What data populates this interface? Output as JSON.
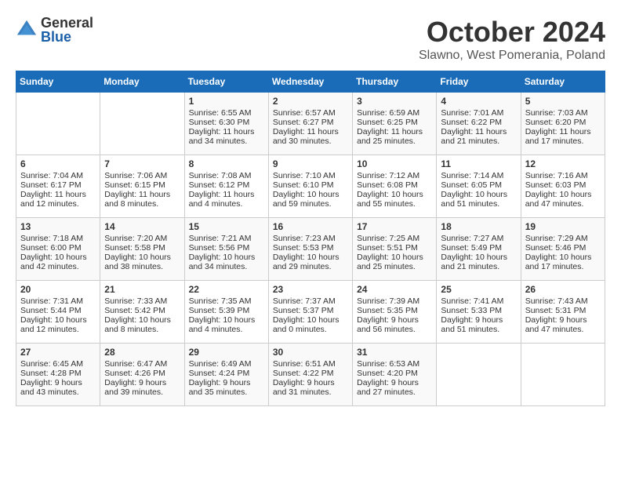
{
  "header": {
    "logo_general": "General",
    "logo_blue": "Blue",
    "month_title": "October 2024",
    "location": "Slawno, West Pomerania, Poland"
  },
  "weekdays": [
    "Sunday",
    "Monday",
    "Tuesday",
    "Wednesday",
    "Thursday",
    "Friday",
    "Saturday"
  ],
  "weeks": [
    [
      {
        "day": "",
        "content": ""
      },
      {
        "day": "",
        "content": ""
      },
      {
        "day": "1",
        "content": "Sunrise: 6:55 AM\nSunset: 6:30 PM\nDaylight: 11 hours\nand 34 minutes."
      },
      {
        "day": "2",
        "content": "Sunrise: 6:57 AM\nSunset: 6:27 PM\nDaylight: 11 hours\nand 30 minutes."
      },
      {
        "day": "3",
        "content": "Sunrise: 6:59 AM\nSunset: 6:25 PM\nDaylight: 11 hours\nand 25 minutes."
      },
      {
        "day": "4",
        "content": "Sunrise: 7:01 AM\nSunset: 6:22 PM\nDaylight: 11 hours\nand 21 minutes."
      },
      {
        "day": "5",
        "content": "Sunrise: 7:03 AM\nSunset: 6:20 PM\nDaylight: 11 hours\nand 17 minutes."
      }
    ],
    [
      {
        "day": "6",
        "content": "Sunrise: 7:04 AM\nSunset: 6:17 PM\nDaylight: 11 hours\nand 12 minutes."
      },
      {
        "day": "7",
        "content": "Sunrise: 7:06 AM\nSunset: 6:15 PM\nDaylight: 11 hours\nand 8 minutes."
      },
      {
        "day": "8",
        "content": "Sunrise: 7:08 AM\nSunset: 6:12 PM\nDaylight: 11 hours\nand 4 minutes."
      },
      {
        "day": "9",
        "content": "Sunrise: 7:10 AM\nSunset: 6:10 PM\nDaylight: 10 hours\nand 59 minutes."
      },
      {
        "day": "10",
        "content": "Sunrise: 7:12 AM\nSunset: 6:08 PM\nDaylight: 10 hours\nand 55 minutes."
      },
      {
        "day": "11",
        "content": "Sunrise: 7:14 AM\nSunset: 6:05 PM\nDaylight: 10 hours\nand 51 minutes."
      },
      {
        "day": "12",
        "content": "Sunrise: 7:16 AM\nSunset: 6:03 PM\nDaylight: 10 hours\nand 47 minutes."
      }
    ],
    [
      {
        "day": "13",
        "content": "Sunrise: 7:18 AM\nSunset: 6:00 PM\nDaylight: 10 hours\nand 42 minutes."
      },
      {
        "day": "14",
        "content": "Sunrise: 7:20 AM\nSunset: 5:58 PM\nDaylight: 10 hours\nand 38 minutes."
      },
      {
        "day": "15",
        "content": "Sunrise: 7:21 AM\nSunset: 5:56 PM\nDaylight: 10 hours\nand 34 minutes."
      },
      {
        "day": "16",
        "content": "Sunrise: 7:23 AM\nSunset: 5:53 PM\nDaylight: 10 hours\nand 29 minutes."
      },
      {
        "day": "17",
        "content": "Sunrise: 7:25 AM\nSunset: 5:51 PM\nDaylight: 10 hours\nand 25 minutes."
      },
      {
        "day": "18",
        "content": "Sunrise: 7:27 AM\nSunset: 5:49 PM\nDaylight: 10 hours\nand 21 minutes."
      },
      {
        "day": "19",
        "content": "Sunrise: 7:29 AM\nSunset: 5:46 PM\nDaylight: 10 hours\nand 17 minutes."
      }
    ],
    [
      {
        "day": "20",
        "content": "Sunrise: 7:31 AM\nSunset: 5:44 PM\nDaylight: 10 hours\nand 12 minutes."
      },
      {
        "day": "21",
        "content": "Sunrise: 7:33 AM\nSunset: 5:42 PM\nDaylight: 10 hours\nand 8 minutes."
      },
      {
        "day": "22",
        "content": "Sunrise: 7:35 AM\nSunset: 5:39 PM\nDaylight: 10 hours\nand 4 minutes."
      },
      {
        "day": "23",
        "content": "Sunrise: 7:37 AM\nSunset: 5:37 PM\nDaylight: 10 hours\nand 0 minutes."
      },
      {
        "day": "24",
        "content": "Sunrise: 7:39 AM\nSunset: 5:35 PM\nDaylight: 9 hours\nand 56 minutes."
      },
      {
        "day": "25",
        "content": "Sunrise: 7:41 AM\nSunset: 5:33 PM\nDaylight: 9 hours\nand 51 minutes."
      },
      {
        "day": "26",
        "content": "Sunrise: 7:43 AM\nSunset: 5:31 PM\nDaylight: 9 hours\nand 47 minutes."
      }
    ],
    [
      {
        "day": "27",
        "content": "Sunrise: 6:45 AM\nSunset: 4:28 PM\nDaylight: 9 hours\nand 43 minutes."
      },
      {
        "day": "28",
        "content": "Sunrise: 6:47 AM\nSunset: 4:26 PM\nDaylight: 9 hours\nand 39 minutes."
      },
      {
        "day": "29",
        "content": "Sunrise: 6:49 AM\nSunset: 4:24 PM\nDaylight: 9 hours\nand 35 minutes."
      },
      {
        "day": "30",
        "content": "Sunrise: 6:51 AM\nSunset: 4:22 PM\nDaylight: 9 hours\nand 31 minutes."
      },
      {
        "day": "31",
        "content": "Sunrise: 6:53 AM\nSunset: 4:20 PM\nDaylight: 9 hours\nand 27 minutes."
      },
      {
        "day": "",
        "content": ""
      },
      {
        "day": "",
        "content": ""
      }
    ]
  ]
}
